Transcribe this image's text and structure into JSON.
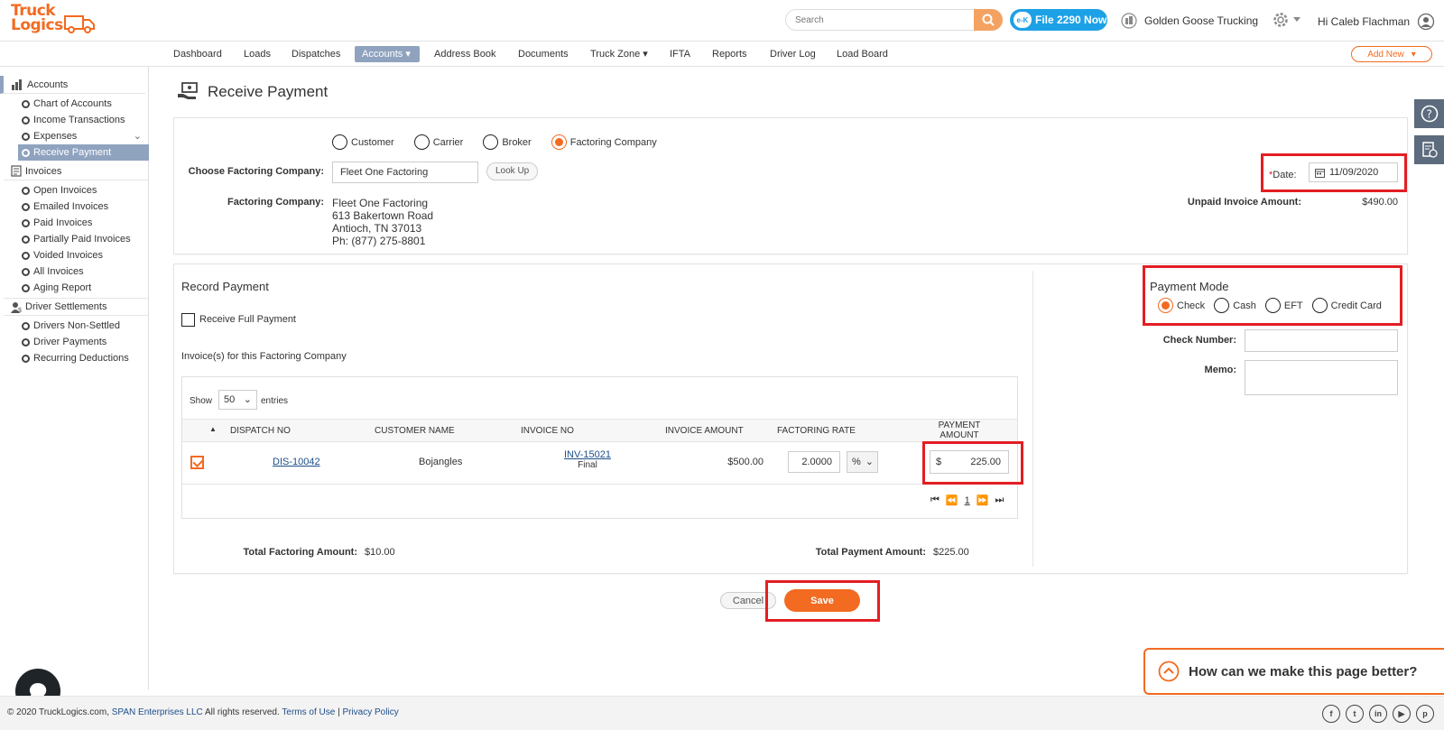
{
  "header": {
    "logo_line1": "Truck",
    "logo_line2": "Logics",
    "search_placeholder": "Search",
    "file_badge": "e-K",
    "file_btn": "File 2290 Now",
    "company": "Golden Goose Trucking",
    "user": "Hi Caleb Flachman"
  },
  "nav": {
    "items": [
      "Dashboard",
      "Loads",
      "Dispatches",
      "Accounts",
      "Address Book",
      "Documents",
      "Truck Zone",
      "IFTA",
      "Reports",
      "Driver Log",
      "Load Board"
    ],
    "add_new": "Add New"
  },
  "sidebar": {
    "accounts": "Accounts",
    "accounts_items": [
      "Chart of Accounts",
      "Income Transactions",
      "Expenses",
      "Receive Payment"
    ],
    "invoices": "Invoices",
    "invoices_items": [
      "Open Invoices",
      "Emailed Invoices",
      "Paid Invoices",
      "Partially Paid Invoices",
      "Voided Invoices",
      "All Invoices",
      "Aging Report"
    ],
    "settlements": "Driver Settlements",
    "settlements_items": [
      "Drivers Non-Settled",
      "Driver Payments",
      "Recurring Deductions"
    ]
  },
  "page": {
    "title": "Receive Payment"
  },
  "payer": {
    "options": [
      "Customer",
      "Carrier",
      "Broker",
      "Factoring Company"
    ],
    "choose_label": "Choose Factoring Company:",
    "choose_value": "Fleet One Factoring",
    "lookup": "Look Up",
    "company_label": "Factoring Company:",
    "company_name": "Fleet One Factoring",
    "address1": "613 Bakertown Road",
    "address2": "Antioch, TN 37013",
    "phone": "Ph: (877) 275-8801",
    "date_label": "Date:",
    "date_required": "*",
    "date_value": "11/09/2020",
    "unpaid_label": "Unpaid Invoice Amount:",
    "unpaid_value": "$490.00"
  },
  "record": {
    "title": "Record Payment",
    "full_payment": "Receive Full Payment",
    "invoices_for": "Invoice(s) for this Factoring Company",
    "show": "Show",
    "entries_value": "50",
    "entries": "entries",
    "columns": [
      "DISPATCH NO",
      "CUSTOMER NAME",
      "INVOICE NO",
      "INVOICE AMOUNT",
      "FACTORING RATE",
      "PAYMENT",
      "AMOUNT"
    ],
    "row": {
      "dispatch": "DIS-10042",
      "customer": "Bojangles",
      "invoice": "INV-15021",
      "invoice_status": "Final",
      "amount": "$500.00",
      "rate": "2.0000",
      "rate_unit": "%",
      "currency": "$",
      "payment": "225.00"
    },
    "page_num": "1",
    "total_factoring_label": "Total Factoring Amount:",
    "total_factoring_value": "$10.00",
    "total_payment_label": "Total Payment Amount:",
    "total_payment_value": "$225.00"
  },
  "payment_mode": {
    "title": "Payment Mode",
    "options": [
      "Check",
      "Cash",
      "EFT",
      "Credit Card"
    ],
    "check_label": "Check Number:",
    "memo_label": "Memo:"
  },
  "actions": {
    "cancel": "Cancel",
    "save": "Save"
  },
  "feedback": "How can we make this page better?",
  "footer": {
    "copyright": "© 2020 TruckLogics.com,",
    "span": "SPAN Enterprises LLC",
    "rights": " All rights reserved.",
    "terms": "Terms of Use",
    "sep": " | ",
    "privacy": "Privacy Policy"
  },
  "colors": {
    "brand_orange": "#f26b21",
    "nav_active": "#8fa3bf",
    "file_blue": "#1da1e6",
    "highlight_red": "#e31e24"
  }
}
